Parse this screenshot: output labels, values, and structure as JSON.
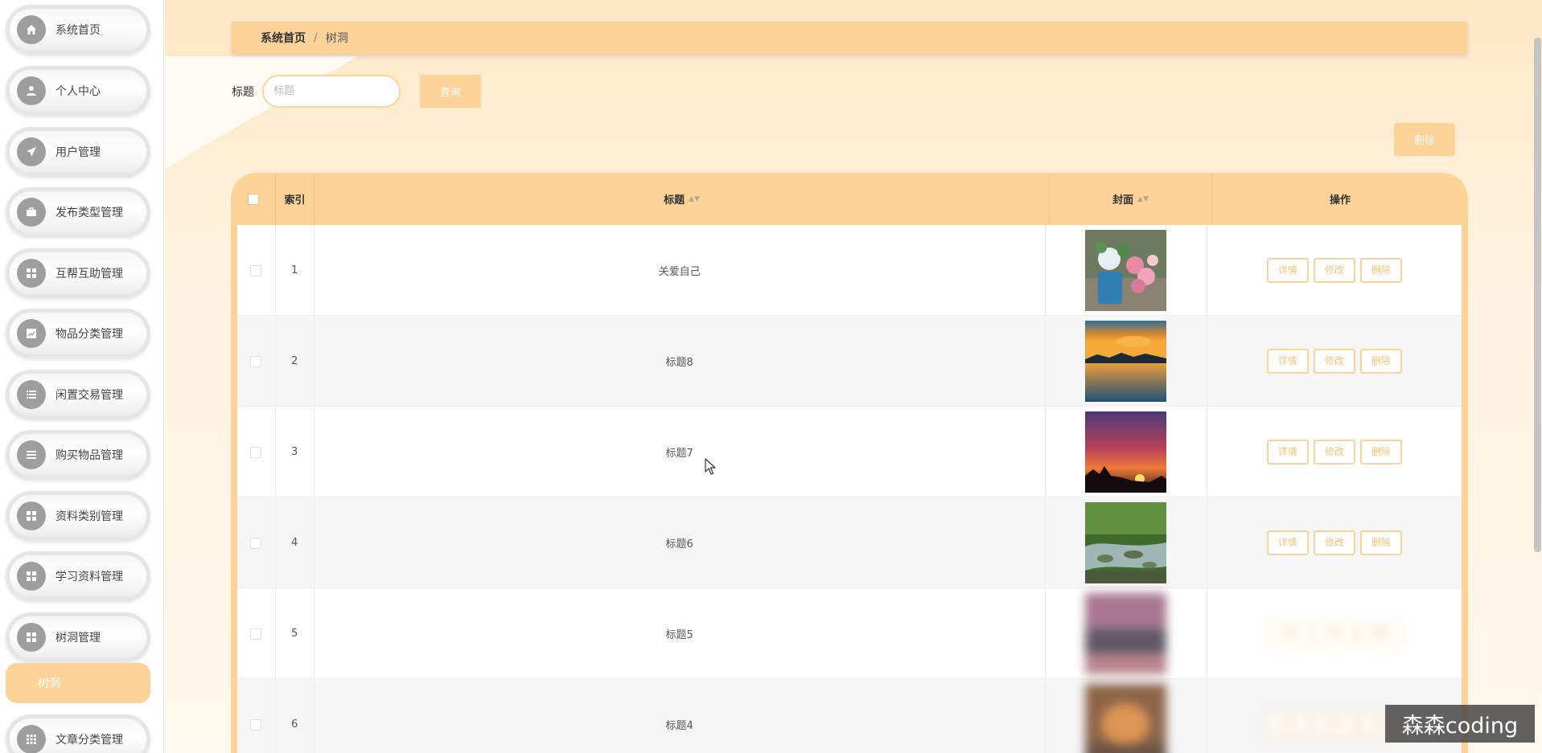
{
  "sidebar": {
    "items": [
      {
        "label": "系统首页",
        "icon": "home-icon"
      },
      {
        "label": "个人中心",
        "icon": "user-icon"
      },
      {
        "label": "用户管理",
        "icon": "send-icon"
      },
      {
        "label": "发布类型管理",
        "icon": "briefcase-icon"
      },
      {
        "label": "互帮互助管理",
        "icon": "grid-icon"
      },
      {
        "label": "物品分类管理",
        "icon": "chart-icon"
      },
      {
        "label": "闲置交易管理",
        "icon": "list-icon"
      },
      {
        "label": "购买物品管理",
        "icon": "menu-icon"
      },
      {
        "label": "资料类别管理",
        "icon": "grid-icon"
      },
      {
        "label": "学习资料管理",
        "icon": "grid-icon"
      },
      {
        "label": "树洞管理",
        "icon": "grid-icon"
      },
      {
        "label": "文章分类管理",
        "icon": "grid-icon"
      }
    ],
    "active_submenu": "树洞"
  },
  "breadcrumb": {
    "home": "系统首页",
    "separator": "/",
    "current": "树洞"
  },
  "search": {
    "label": "标题",
    "placeholder": "标题",
    "button": "查询"
  },
  "toolbar": {
    "delete_label": "删除"
  },
  "table": {
    "headers": {
      "index": "索引",
      "title": "标题",
      "cover": "封面",
      "action": "操作"
    },
    "rows": [
      {
        "index": "1",
        "title": "关爱自己",
        "cover": "flowers"
      },
      {
        "index": "2",
        "title": "标题8",
        "cover": "lake-sunset"
      },
      {
        "index": "3",
        "title": "标题7",
        "cover": "red-sunset"
      },
      {
        "index": "4",
        "title": "标题6",
        "cover": "forest-stream"
      },
      {
        "index": "5",
        "title": "标题5",
        "cover": "dusk"
      },
      {
        "index": "6",
        "title": "标题4",
        "cover": "orange-glow"
      }
    ],
    "row_actions": {
      "detail": "详情",
      "edit": "修改",
      "delete": "删除"
    }
  },
  "watermark": "森森coding",
  "colors": {
    "accent": "#fdd39a",
    "accent_text": "#f3c47c",
    "sidebar_icon": "#9e9e9e"
  }
}
